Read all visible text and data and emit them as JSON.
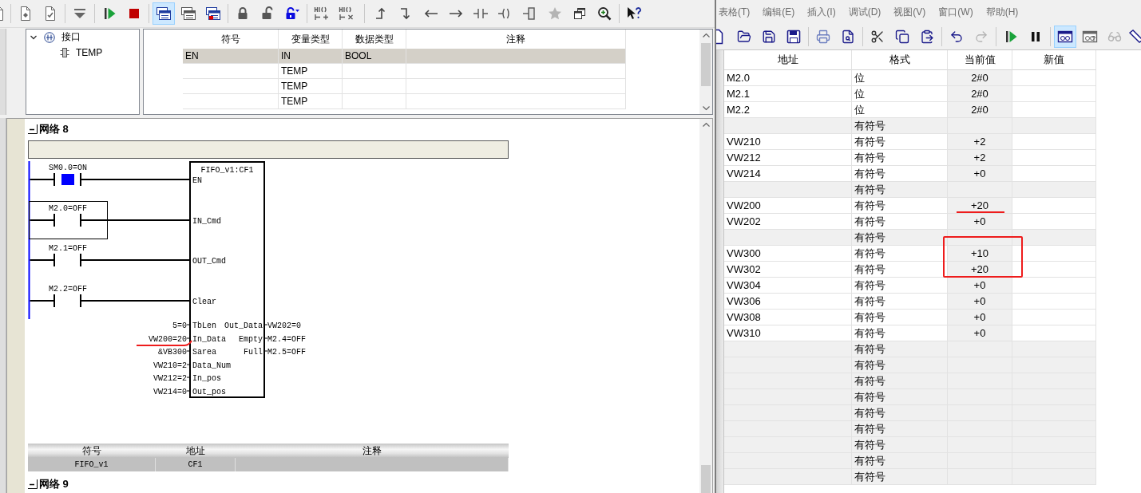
{
  "left_window": {
    "toolbar": [
      {
        "pressed": false,
        "disabled": false
      },
      {
        "pressed": false,
        "disabled": false
      },
      {
        "pressed": false,
        "disabled": false
      },
      {
        "pressed": false,
        "disabled": false
      },
      {
        "pressed": false,
        "disabled": false
      },
      {
        "pressed": true,
        "disabled": false
      },
      {
        "pressed": false,
        "disabled": false
      },
      {
        "pressed": false,
        "disabled": false
      },
      {
        "pressed": false,
        "disabled": false
      },
      {
        "pressed": false,
        "disabled": false
      },
      {
        "pressed": false,
        "disabled": false
      },
      {
        "pressed": false,
        "disabled": false
      },
      {
        "pressed": false,
        "disabled": false
      },
      {
        "pressed": false,
        "disabled": false
      },
      {
        "pressed": false,
        "disabled": false
      },
      {
        "pressed": false,
        "disabled": false
      },
      {
        "pressed": false,
        "disabled": false
      },
      {
        "pressed": false,
        "disabled": false
      },
      {
        "pressed": false,
        "disabled": false
      },
      {
        "pressed": false,
        "disabled": false
      },
      {
        "pressed": false,
        "disabled": true
      },
      {
        "pressed": false,
        "disabled": false
      },
      {
        "pressed": false,
        "disabled": false
      },
      {
        "pressed": false,
        "disabled": false
      }
    ],
    "interface_tree": [
      {
        "label": "接口",
        "expanded": true,
        "children": [
          {
            "label": "TEMP"
          }
        ]
      }
    ],
    "interface_table": {
      "columns": [
        "符号",
        "变量类型",
        "数据类型",
        "注释"
      ],
      "rows": [
        {
          "symbol": "EN",
          "variable_type": "IN",
          "data_type": "BOOL",
          "readonly": true
        },
        {
          "variable_type": "TEMP",
          "readonly": false
        },
        {
          "variable_type": "TEMP",
          "readonly": false
        },
        {
          "variable_type": "TEMP",
          "readonly": false
        }
      ]
    },
    "networks": [
      {
        "title": "网络 8",
        "expanded": true,
        "ladder": {
          "rungs": [
            {
              "contact": "SM0.0=ON",
              "energized": true,
              "selected": false,
              "pin": "EN"
            },
            {
              "contact": "M2.0=OFF",
              "energized": false,
              "selected": true,
              "pin": "IN_Cmd"
            },
            {
              "contact": "M2.1=OFF",
              "energized": false,
              "selected": false,
              "pin": "OUT_Cmd"
            },
            {
              "contact": "M2.2=OFF",
              "energized": false,
              "selected": false,
              "pin": "Clear"
            }
          ],
          "block_title": "FIFO_v1:CF1",
          "inputs": [
            {
              "value": "5=0",
              "pin": "TbLen"
            },
            {
              "value": "VW200=20",
              "pin": "In_Data",
              "underlined": true
            },
            {
              "value": "&VB300",
              "pin": "Sarea"
            },
            {
              "value": "VW210=2",
              "pin": "Data_Num"
            },
            {
              "value": "VW212=2",
              "pin": "In_pos"
            },
            {
              "value": "VW214=0",
              "pin": "Out_pos"
            }
          ],
          "outputs": [
            {
              "pin": "Out_Data",
              "value": "VW202=0"
            },
            {
              "pin": "Empty",
              "value": "M2.4=OFF"
            },
            {
              "pin": "Full",
              "value": "M2.5=OFF"
            }
          ]
        },
        "symbol_table": {
          "columns": [
            "符号",
            "地址",
            "注释"
          ],
          "rows": [
            {
              "symbol": "FIFO_v1",
              "address": "CF1"
            }
          ]
        }
      },
      {
        "title": "网络 9",
        "expanded": true
      }
    ]
  },
  "right_window": {
    "menu": [
      "表格(T)",
      "编辑(E)",
      "插入(I)",
      "调试(D)",
      "视图(V)",
      "窗口(W)",
      "帮助(H)"
    ],
    "toolbar": [
      {
        "pressed": false,
        "disabled": false
      },
      {
        "pressed": false,
        "disabled": false
      },
      {
        "pressed": false,
        "disabled": false
      },
      {
        "pressed": false,
        "disabled": false
      },
      {
        "pressed": false,
        "disabled": false
      },
      {
        "pressed": false,
        "disabled": false
      },
      {
        "pressed": false,
        "disabled": false
      },
      {
        "pressed": false,
        "disabled": false
      },
      {
        "pressed": false,
        "disabled": false
      },
      {
        "pressed": false,
        "disabled": true
      },
      {
        "pressed": false,
        "disabled": false
      },
      {
        "pressed": false,
        "disabled": false
      },
      {
        "pressed": true,
        "disabled": false
      },
      {
        "pressed": false,
        "disabled": false
      },
      {
        "pressed": false,
        "disabled": true
      }
    ],
    "status_chart": {
      "columns": [
        "地址",
        "格式",
        "当前值",
        "新值"
      ],
      "rows": [
        {
          "address": "M2.0",
          "format": "位",
          "current_value": "2#0"
        },
        {
          "address": "M2.1",
          "format": "位",
          "current_value": "2#0"
        },
        {
          "address": "M2.2",
          "format": "位",
          "current_value": "2#0"
        },
        {
          "format": "有符号"
        },
        {
          "address": "VW210",
          "format": "有符号",
          "current_value": "+2"
        },
        {
          "address": "VW212",
          "format": "有符号",
          "current_value": "+2"
        },
        {
          "address": "VW214",
          "format": "有符号",
          "current_value": "+0"
        },
        {
          "format": "有符号"
        },
        {
          "address": "VW200",
          "format": "有符号",
          "current_value": "+20",
          "underlined": true
        },
        {
          "address": "VW202",
          "format": "有符号",
          "current_value": "+0"
        },
        {
          "format": "有符号"
        },
        {
          "address": "VW300",
          "format": "有符号",
          "current_value": "+10",
          "boxed": true
        },
        {
          "address": "VW302",
          "format": "有符号",
          "current_value": "+20",
          "boxed": true
        },
        {
          "address": "VW304",
          "format": "有符号",
          "current_value": "+0"
        },
        {
          "address": "VW306",
          "format": "有符号",
          "current_value": "+0"
        },
        {
          "address": "VW308",
          "format": "有符号",
          "current_value": "+0"
        },
        {
          "address": "VW310",
          "format": "有符号",
          "current_value": "+0"
        },
        {
          "format": "有符号"
        },
        {
          "format": "有符号"
        },
        {
          "format": "有符号"
        },
        {
          "format": "有符号"
        },
        {
          "format": "有符号"
        },
        {
          "format": "有符号"
        },
        {
          "format": "有符号"
        },
        {
          "format": "有符号"
        },
        {
          "format": "有符号"
        }
      ]
    }
  }
}
